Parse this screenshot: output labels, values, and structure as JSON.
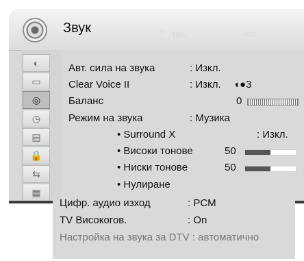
{
  "header": {
    "title": "Звук",
    "hint_move": "Прем.",
    "hint_ok": "⊙OK"
  },
  "sidebar": {
    "items": [
      {
        "icon": "satellite-dish-icon",
        "glyph": "◐"
      },
      {
        "icon": "monitor-icon",
        "glyph": "▭"
      },
      {
        "icon": "speaker-icon",
        "glyph": "◎"
      },
      {
        "icon": "clock-icon",
        "glyph": "◷"
      },
      {
        "icon": "briefcase-icon",
        "glyph": "▤"
      },
      {
        "icon": "lock-icon",
        "glyph": "🔒"
      },
      {
        "icon": "plug-icon",
        "glyph": "⇆"
      },
      {
        "icon": "film-icon",
        "glyph": "▦"
      }
    ],
    "active_index": 2
  },
  "settings": {
    "auto_volume": {
      "label": "Авт. сила на звука",
      "value": ": Изкл."
    },
    "clear_voice": {
      "label": "Clear Voice II",
      "value": ": Изкл.",
      "level": "3"
    },
    "balance": {
      "label": "Баланс",
      "value": "0"
    },
    "sound_mode": {
      "label": "Режим на звука",
      "value": ": Музика"
    },
    "surround": {
      "label": "• Surround X",
      "value": ": Изкл."
    },
    "treble": {
      "label": "• Високи тонове",
      "value": "50",
      "level_fraction": 0.5
    },
    "bass": {
      "label": "• Ниски тонове",
      "value": "50",
      "level_fraction": 0.5
    },
    "reset": {
      "label": "• Нулиране"
    },
    "digital_out": {
      "label": "Цифр. аудио изход",
      "value": ": PCM"
    },
    "tv_speaker": {
      "label": "TV Високогов.",
      "value": ": On"
    },
    "dtv_sound": {
      "label": "Настройка на звука за DTV : автоматично"
    }
  },
  "colors": {
    "panel": "#d9d9d9",
    "bar_fill": "#555555"
  }
}
